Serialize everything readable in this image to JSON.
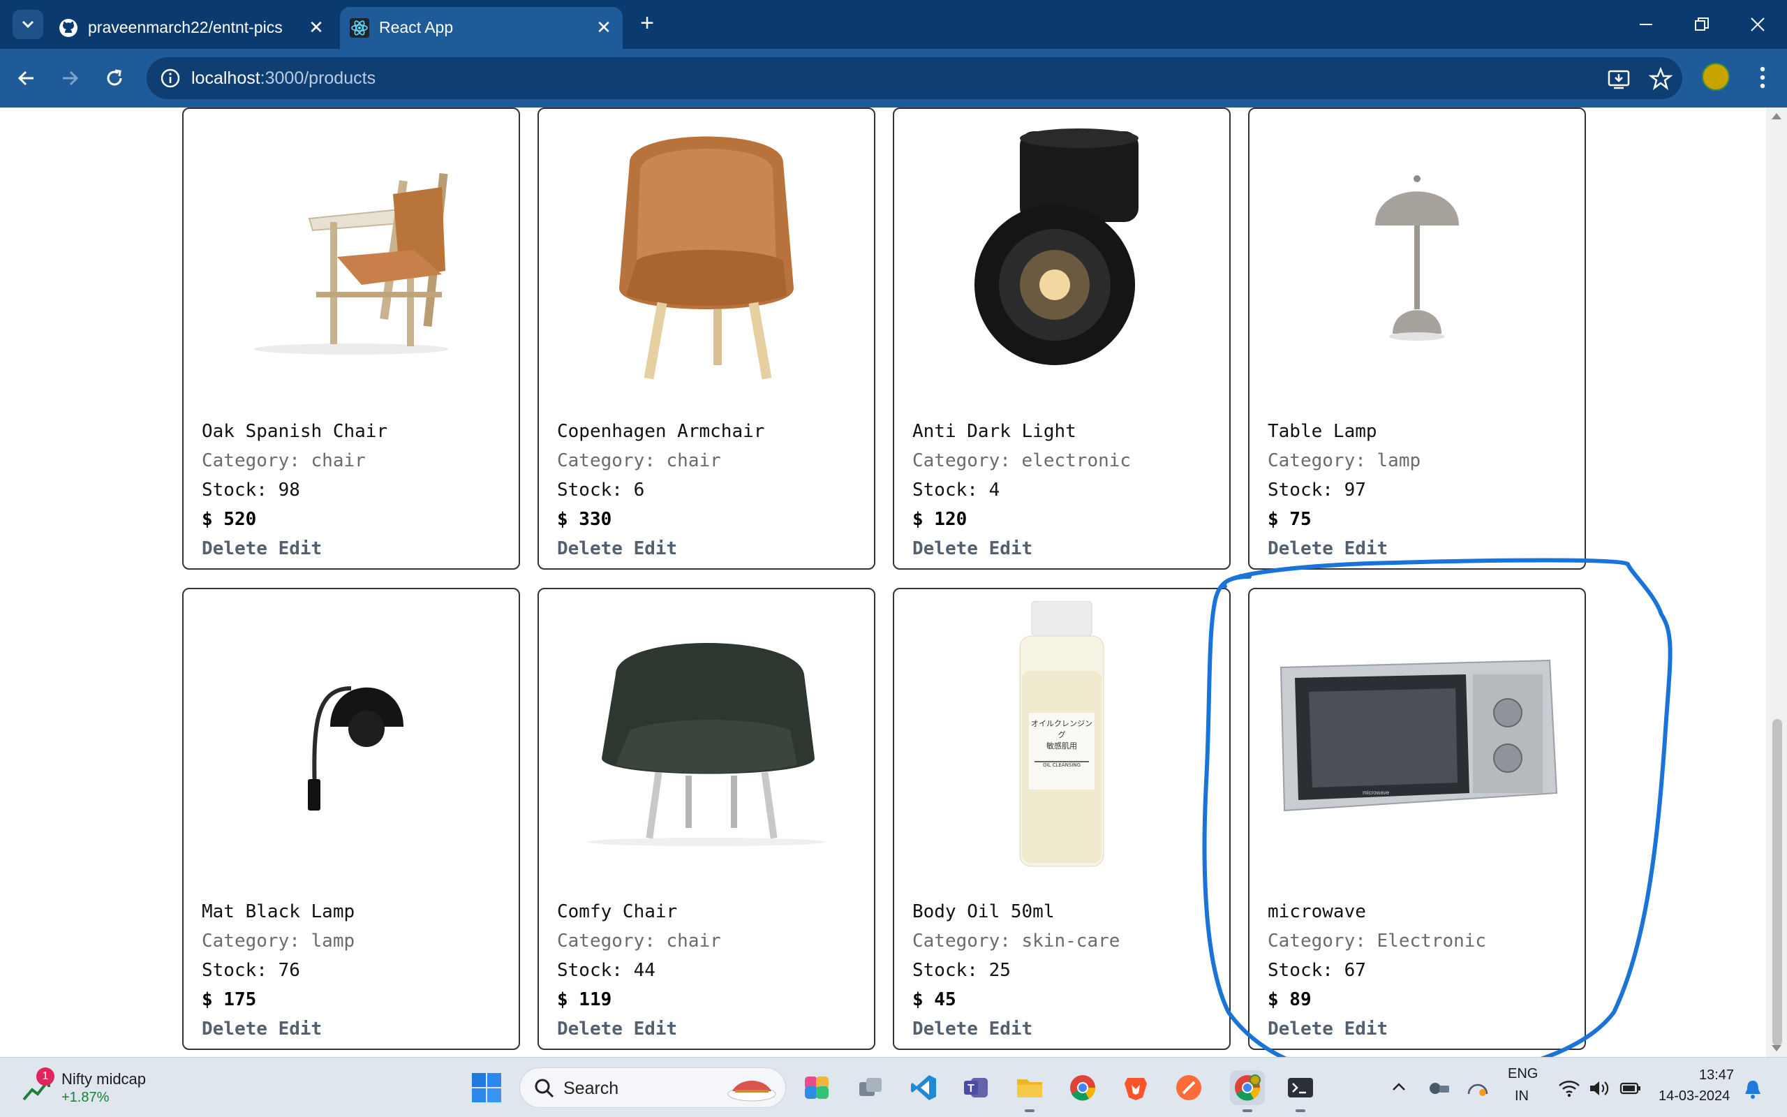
{
  "browser": {
    "tabs": [
      {
        "title": "praveenmarch22/entnt-pics",
        "favicon": "github-icon",
        "active": false
      },
      {
        "title": "React App",
        "favicon": "react-icon",
        "active": true
      }
    ],
    "url_host": "localhost",
    "url_path": ":3000/products"
  },
  "products": [
    {
      "name": "Oak Spanish Chair",
      "category": "Category: chair",
      "stock": "Stock: 98",
      "price": "$ 520",
      "image": "oak-chair-image"
    },
    {
      "name": "Copenhagen Armchair",
      "category": "Category: chair",
      "stock": "Stock: 6",
      "price": "$ 330",
      "image": "tan-armchair-image"
    },
    {
      "name": "Anti Dark Light",
      "category": "Category: electronic",
      "stock": "Stock: 4",
      "price": "$ 120",
      "image": "spotlight-image"
    },
    {
      "name": "Table Lamp",
      "category": "Category: lamp",
      "stock": "Stock: 97",
      "price": "$ 75",
      "image": "table-lamp-image"
    },
    {
      "name": "Mat Black Lamp",
      "category": "Category: lamp",
      "stock": "Stock: 76",
      "price": "$ 175",
      "image": "wall-lamp-image"
    },
    {
      "name": "Comfy Chair",
      "category": "Category: chair",
      "stock": "Stock: 44",
      "price": "$ 119",
      "image": "green-chair-image"
    },
    {
      "name": "Body Oil 50ml",
      "category": "Category: skin-care",
      "stock": "Stock: 25",
      "price": "$ 45",
      "image": "oil-bottle-image"
    },
    {
      "name": "microwave",
      "category": "Category: Electronic",
      "stock": "Stock: 67",
      "price": "$ 89",
      "image": "microwave-image"
    }
  ],
  "actions": {
    "delete_label": "Delete",
    "edit_label": "Edit"
  },
  "bottle_label": {
    "line1": "オイルクレンジング",
    "line2": "敏感肌用",
    "line3": "OIL CLEANSING"
  },
  "microwave_brand": "microwave",
  "taskbar": {
    "widget_badge": "1",
    "widget_title": "Nifty midcap",
    "widget_value": "+1.87%",
    "search_label": "Search",
    "language_top": "ENG",
    "language_bottom": "IN",
    "time": "13:47",
    "date": "14-03-2024"
  },
  "colors": {
    "tab_strip": "#0b3b6e",
    "toolbar": "#1f5b99",
    "highlight_stroke": "#1a73d6",
    "positive": "#1a7f37"
  }
}
